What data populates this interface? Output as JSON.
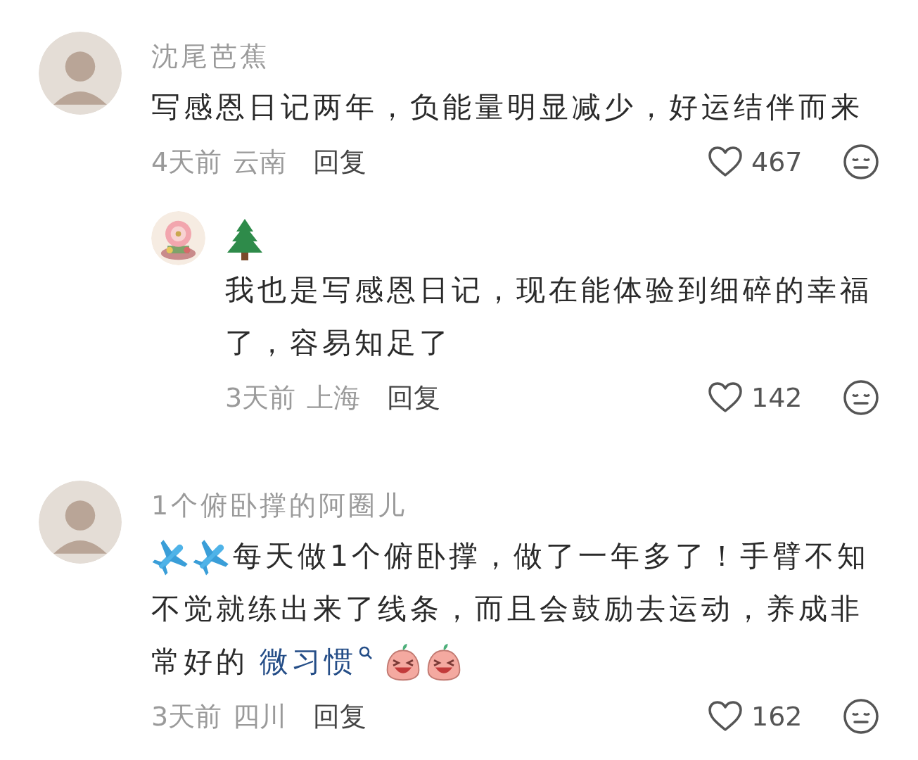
{
  "comments": [
    {
      "author": [
        {
          "kind": "text",
          "text": "沈尾芭蕉"
        }
      ],
      "avatar": {
        "kind": "silhouette"
      },
      "lines": [
        [
          {
            "kind": "text",
            "text": "写感恩日记两年，负能量明显减少，好运结伴而来"
          }
        ]
      ],
      "time": "4天前",
      "location": "云南",
      "reply_label": "回复",
      "likes": "467",
      "replies": [
        {
          "author": [
            {
              "kind": "tree"
            }
          ],
          "avatar": {
            "kind": "picture"
          },
          "lines": [
            [
              {
                "kind": "text",
                "text": "我也是写感恩日记，现在能体验到细碎的幸福"
              }
            ],
            [
              {
                "kind": "text",
                "text": "了，容易知足了"
              }
            ]
          ],
          "time": "3天前",
          "location": "上海",
          "reply_label": "回复",
          "likes": "142"
        }
      ]
    },
    {
      "author": [
        {
          "kind": "text",
          "text": "1个俯卧撑的阿圈儿"
        }
      ],
      "avatar": {
        "kind": "silhouette"
      },
      "lines": [
        [
          {
            "kind": "airplane"
          },
          {
            "kind": "airplane"
          },
          {
            "kind": "text",
            "text": "每天做1个俯卧撑，做了一年多了！手臂不知"
          }
        ],
        [
          {
            "kind": "text",
            "text": "不觉就练出来了线条，而且会鼓励去运动，养成非"
          }
        ],
        [
          {
            "kind": "text",
            "text": "常好的"
          },
          {
            "kind": "link",
            "text": "微习惯"
          },
          {
            "kind": "laugh"
          },
          {
            "kind": "laugh"
          }
        ]
      ],
      "time": "3天前",
      "location": "四川",
      "reply_label": "回复",
      "likes": "162"
    }
  ]
}
